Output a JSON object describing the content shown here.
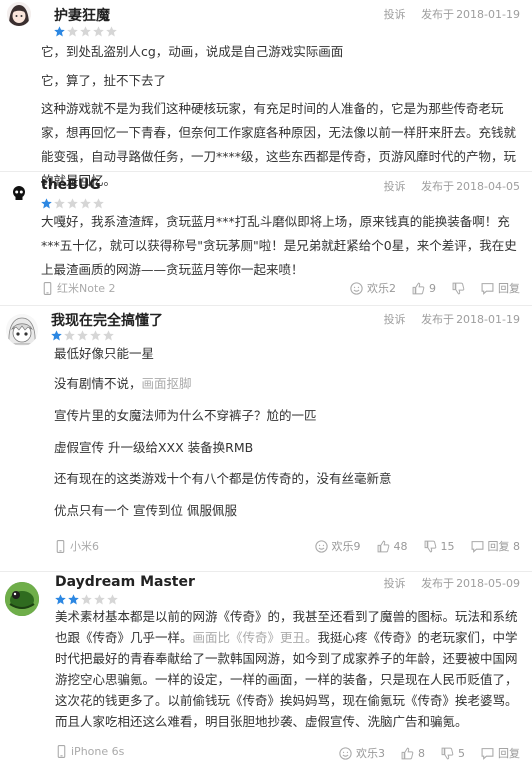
{
  "colors": {
    "star_on": "#2c87e2",
    "star_off": "#d6d6d6",
    "muted": "#9e9e9e"
  },
  "meta_labels": {
    "report": "投诉",
    "posted_prefix": "发布于"
  },
  "reviews": [
    {
      "user": "护妻狂魔",
      "rating": 1,
      "rating_max": 5,
      "date": "2018-01-19",
      "paragraphs": [
        "它，到处乱盗别人cg，动画，说成是自己游戏实际画面",
        "它，算了，扯不下去了",
        "这种游戏就不是为我们这种硬核玩家，有充足时间的人准备的，它是为那些传奇老玩家，想再回忆一下青春，但奈何工作家庭各种原因，无法像以前一样肝来肝去。充钱就能变强，自动寻路做任务，一刀****级，这些东西都是传奇，页游风靡时代的产物，玩的就是回忆。"
      ]
    },
    {
      "user": "theBUG",
      "rating": 1,
      "rating_max": 5,
      "date": "2018-04-05",
      "paragraphs": [
        "大嘎好，我系渣渣辉，贪玩蓝月***打乱斗磨似即将上场，原来钱真的能换装备啊！充***五十亿，就可以获得称号\"贪玩茅厕\"啦！是兄弟就赶紧给个0星，来个差评，我在史上最渣画质的网游——贪玩蓝月等你一起来喷！"
      ],
      "device": "红米Note 2",
      "actions": {
        "fun_label": "欢乐",
        "fun": "2",
        "likes": "9",
        "dislikes": "",
        "reply": "回复"
      }
    },
    {
      "user": "我现在完全搞懂了",
      "rating": 1,
      "rating_max": 5,
      "date": "2018-01-19",
      "paragraphs": [
        "最低好像只能一星",
        "没有剧情不说，",
        "宣传片里的女魔法师为什么不穿裤子？尬的一匹",
        "虚假宣传 升一级给XXX 装备换RMB",
        "还有现在的这类游戏十个有八个都是仿传奇的，没有丝毫新意",
        "优点只有一个 宣传到位 佩服佩服"
      ],
      "inline_note": "画面抠脚",
      "device": "小米6",
      "actions": {
        "fun_label": "欢乐",
        "fun": "9",
        "likes": "48",
        "dislikes": "15",
        "reply": "回复",
        "reply_count": "8"
      }
    },
    {
      "user": "Daydream Master",
      "rating": 2,
      "rating_max": 5,
      "date": "2018-05-09",
      "para_parts": [
        "美术素材基本都是以前的网游《传奇》的，我甚至还看到了魔兽的图标。玩法和系统也跟《传奇》几乎一样。",
        "画面比《传奇》更丑。",
        "我挺心疼《传奇》的老玩家们，中学时代把最好的青春奉献给了一款韩国网游，如今到了成家养子的年龄，还要被中国网游挖空心思骗氪。一样的设定，一样的画面，一样的装备，只是现在人民币贬值了，这次花的钱更多了。以前偷钱玩《传奇》挨妈妈骂，现在偷氪玩《传奇》挨老婆骂。而且人家吃相还这么难看，明目张胆地抄袭、虚假宣传、洗脑广告和骗氪。"
      ],
      "device": "iPhone 6s",
      "actions": {
        "fun_label": "欢乐",
        "fun": "3",
        "likes": "8",
        "dislikes": "5",
        "reply": "回复"
      }
    }
  ]
}
